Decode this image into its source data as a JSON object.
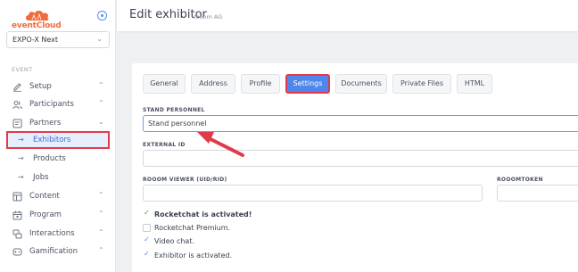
{
  "brand": {
    "name": "eventCloud"
  },
  "event_select": {
    "value": "EXPO-X Next"
  },
  "sidebar": {
    "section_label": "EVENT",
    "items": [
      {
        "label": "Setup",
        "icon": "edit-icon"
      },
      {
        "label": "Participants",
        "icon": "users-icon"
      },
      {
        "label": "Partners",
        "icon": "partners-icon"
      },
      {
        "label": "Content",
        "icon": "content-icon"
      },
      {
        "label": "Program",
        "icon": "calendar-icon"
      },
      {
        "label": "Interactions",
        "icon": "interactions-icon"
      },
      {
        "label": "Gamification",
        "icon": "gamification-icon"
      }
    ],
    "partners_sub": [
      {
        "label": "Exhibitors"
      },
      {
        "label": "Products"
      },
      {
        "label": "Jobs"
      }
    ]
  },
  "header": {
    "title": "Edit exhibitor",
    "subtitle": "rooom AG"
  },
  "tabs": [
    {
      "label": "General"
    },
    {
      "label": "Address"
    },
    {
      "label": "Profile"
    },
    {
      "label": "Settings"
    },
    {
      "label": "Documents"
    },
    {
      "label": "Private Files"
    },
    {
      "label": "HTML"
    }
  ],
  "form": {
    "stand_personnel_label": "STAND PERSONNEL",
    "stand_personnel_value": "Stand personnel",
    "external_id_label": "EXTERNAL ID",
    "external_id_value": "",
    "viewer_label": "ROOOM VIEWER (UID/RID)",
    "viewer_value": "",
    "token_label": "ROOOMTOKEN",
    "token_value": ""
  },
  "checks": [
    {
      "label": "Rocketchat is activated!",
      "checked": true
    },
    {
      "label": "Rocketchat Premium.",
      "checked": false
    },
    {
      "label": "Video chat.",
      "checked": true
    },
    {
      "label": "Exhibitor is activated.",
      "checked": true
    }
  ],
  "colors": {
    "accent": "#4f86ec",
    "highlight": "#e23a4a",
    "brand": "#f26b38",
    "check_green": "#3aa65a"
  }
}
